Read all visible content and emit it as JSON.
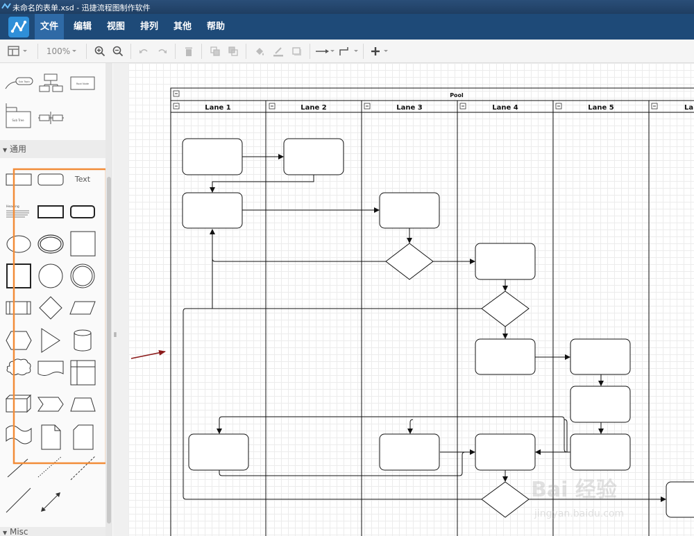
{
  "window": {
    "title": "未命名的表单.xsd - 迅捷流程图制作软件"
  },
  "menu": {
    "items": [
      "文件",
      "编辑",
      "视图",
      "排列",
      "其他",
      "帮助"
    ],
    "active_index": 0
  },
  "toolbar": {
    "zoom_value": "100%",
    "icons": [
      "layout-icon",
      "zoom-in-icon",
      "zoom-out-icon",
      "undo-icon",
      "redo-icon",
      "delete-icon",
      "to-front-icon",
      "to-back-icon",
      "fill-color-icon",
      "line-color-icon",
      "shadow-icon",
      "connection-style-icon",
      "waypoint-style-icon",
      "insert-icon"
    ]
  },
  "sidebar": {
    "section_general": "通用",
    "section_misc": "Misc",
    "shape_text_label": "Text",
    "shape_heading_label": "Heading",
    "top_shape_labels": [
      "Sub Topic",
      "Root Node",
      "Sub Tree"
    ],
    "highlight_color": "#f28c38"
  },
  "splitter": {
    "handle": "⦀"
  },
  "diagram": {
    "pool_label": "Pool",
    "lanes": [
      "Lane 1",
      "Lane 2",
      "Lane 3",
      "Lane 4",
      "Lane 5",
      "La"
    ]
  },
  "watermark": {
    "text": "Bai 经验",
    "url_text": "jingyan.baidu.com"
  }
}
